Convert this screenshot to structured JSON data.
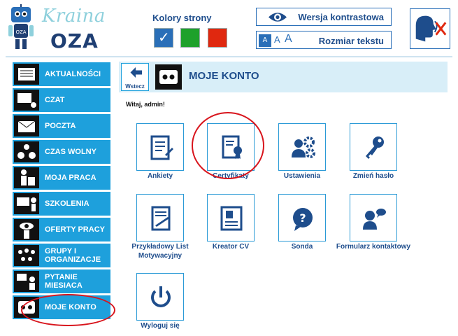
{
  "header": {
    "logo_kraina": "Kraina",
    "logo_oza": "OZA",
    "colors_label": "Kolory strony",
    "contrast_label": "Wersja kontrastowa",
    "textsize_label": "Rozmiar tekstu",
    "textsize_a": "A"
  },
  "sidebar": {
    "items": [
      {
        "label": "AKTUALNOŚCI"
      },
      {
        "label": "CZAT"
      },
      {
        "label": "POCZTA"
      },
      {
        "label": "CZAS WOLNY"
      },
      {
        "label": "MOJA PRACA"
      },
      {
        "label": "SZKOLENIA"
      },
      {
        "label": "OFERTY PRACY"
      },
      {
        "label": "GRUPY I ORGANIZACJE"
      },
      {
        "label": "PYTANIE MIESIACA"
      },
      {
        "label": "MOJE KONTO"
      }
    ]
  },
  "main": {
    "back_label": "Wstecz",
    "title": "MOJE KONTO",
    "greeting": "Witaj, admin!",
    "tiles": [
      {
        "label": "Ankiety",
        "icon": "survey-icon"
      },
      {
        "label": "Certyfikaty",
        "icon": "certificate-icon"
      },
      {
        "label": "Ustawienia",
        "icon": "settings-icon"
      },
      {
        "label": "Zmień hasło",
        "icon": "key-icon"
      },
      {
        "label": "Przykładowy List Motywacyjny",
        "icon": "letter-icon"
      },
      {
        "label": "Kreator CV",
        "icon": "cv-icon"
      },
      {
        "label": "Sonda",
        "icon": "poll-icon"
      },
      {
        "label": "Formularz kontaktowy",
        "icon": "contact-icon"
      },
      {
        "label": "Wyloguj się",
        "icon": "logout-icon"
      }
    ]
  },
  "colors": {
    "accent": "#1ea0dc",
    "dark_blue": "#1e4d8c",
    "highlight": "#d8141c",
    "swatches": [
      "#2a6fb8",
      "#1ea12b",
      "#e0280f"
    ]
  }
}
